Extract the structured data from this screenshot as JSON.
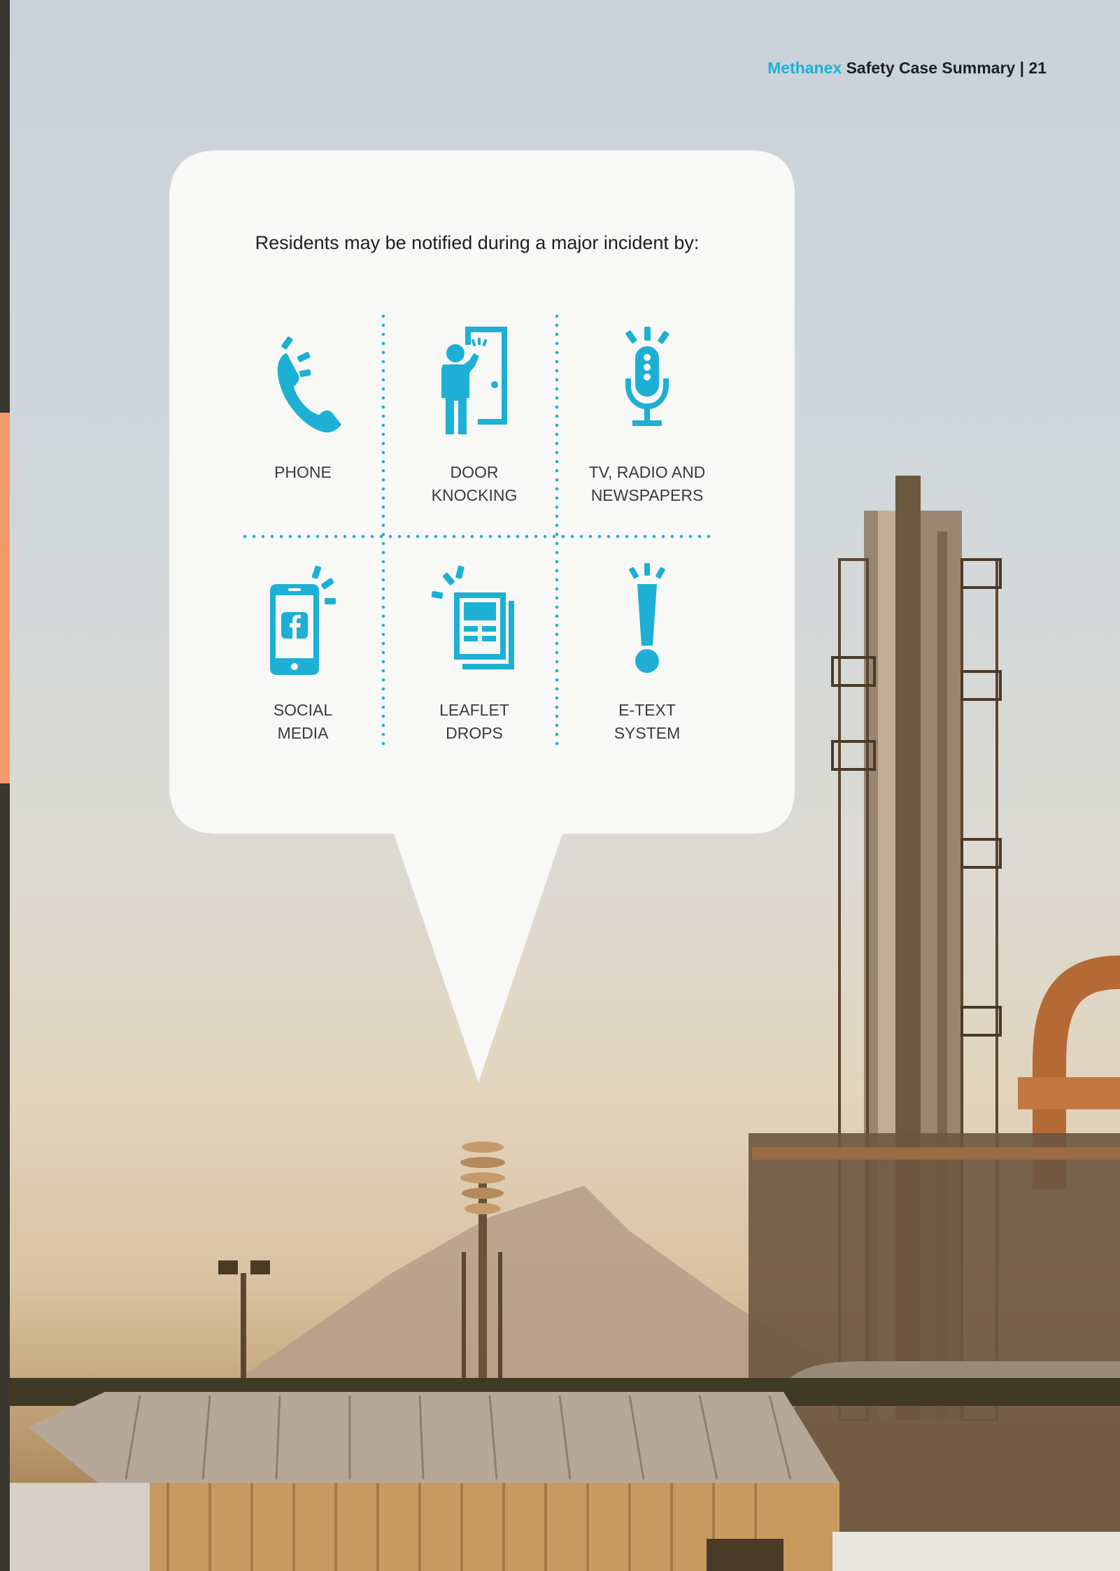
{
  "header": {
    "brand": "Methanex",
    "title": "Safety Case Summary | 21"
  },
  "intro": "Residents may be notified during a major incident by:",
  "methods": [
    {
      "id": "phone",
      "line1": "PHONE",
      "line2": ""
    },
    {
      "id": "door",
      "line1": "DOOR",
      "line2": "KNOCKING"
    },
    {
      "id": "media",
      "line1": "TV, RADIO AND",
      "line2": "NEWSPAPERS"
    },
    {
      "id": "social",
      "line1": "SOCIAL",
      "line2": "MEDIA"
    },
    {
      "id": "leaflet",
      "line1": "LEAFLET",
      "line2": "DROPS"
    },
    {
      "id": "etext",
      "line1": "E-TEXT",
      "line2": "SYSTEM"
    }
  ],
  "colors": {
    "accent": "#1db0d4",
    "bubble": "#f8f8f7",
    "side_strip": "#f39a6d"
  },
  "icons": [
    "phone-icon",
    "door-knock-icon",
    "microphone-icon",
    "smartphone-facebook-icon",
    "leaflet-icon",
    "exclamation-icon"
  ]
}
